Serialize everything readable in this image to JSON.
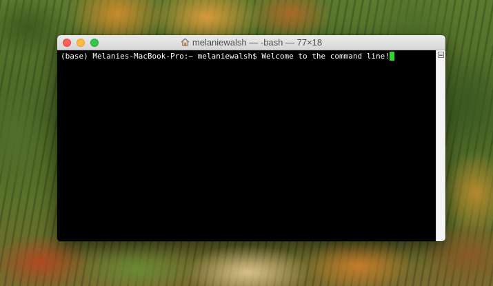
{
  "desktop": {
    "wallpaper": "autumn-forest"
  },
  "window": {
    "title": "melaniewalsh — -bash — 77×18",
    "title_icon": "home-icon",
    "colors": {
      "close": "#fc605b",
      "minimize": "#fdbc40",
      "zoom": "#34c84a",
      "background": "#000000",
      "text": "#ffffff",
      "cursor": "#2bd92b"
    }
  },
  "terminal": {
    "prompt": "(base) Melanies-MacBook-Pro:~ melaniewalsh$ ",
    "input": "Welcome to the command line!"
  },
  "scrollbar": {
    "split_icon": "split-pane-icon"
  }
}
